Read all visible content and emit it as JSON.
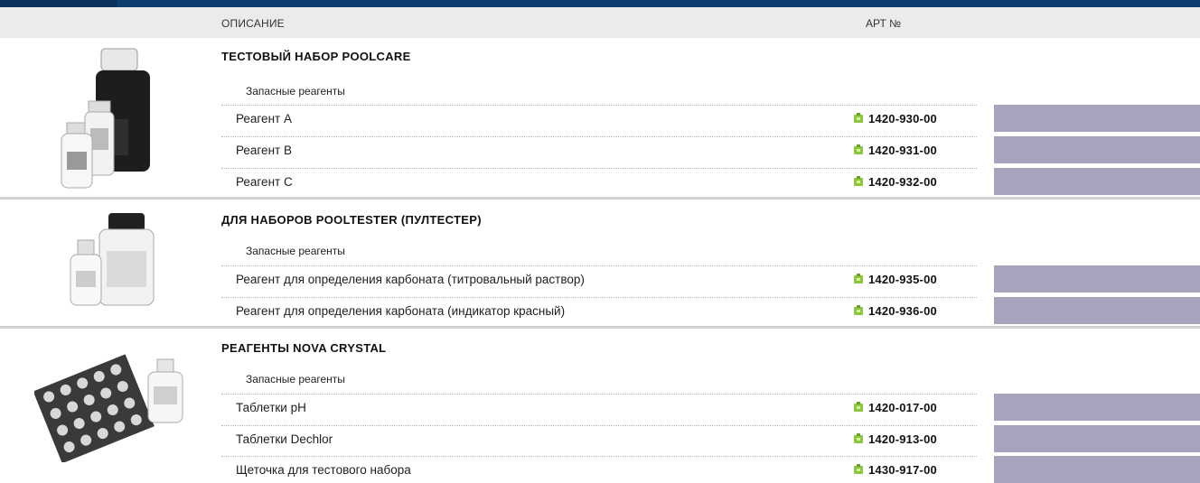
{
  "header": {
    "description_label": "ОПИСАНИЕ",
    "art_label": "АРТ №"
  },
  "colors": {
    "topbar": "#0d3d6e",
    "swatch": "#a8a3bd",
    "icon": "#8cc63f"
  },
  "sections": [
    {
      "title": "ТЕСТОВЫЙ НАБОР POOLCARE",
      "subtitle": "Запасные реагенты",
      "items": [
        {
          "name": "Реагент А",
          "art": "1420-930-00"
        },
        {
          "name": "Реагент В",
          "art": "1420-931-00"
        },
        {
          "name": "Реагент С",
          "art": "1420-932-00"
        }
      ]
    },
    {
      "title": "ДЛЯ НАБОРОВ POOLTESTER (ПУЛТЕСТЕР)",
      "subtitle": "Запасные реагенты",
      "items": [
        {
          "name": "Реагент для определения карбоната (титровальный раствор)",
          "art": "1420-935-00"
        },
        {
          "name": "Реагент для определения карбоната (индикатор красный)",
          "art": "1420-936-00"
        }
      ]
    },
    {
      "title": "РЕАГЕНТЫ NOVA CRYSTAL",
      "subtitle": "Запасные реагенты",
      "items": [
        {
          "name": "Таблетки pH",
          "art": "1420-017-00"
        },
        {
          "name": "Таблетки Dechlor",
          "art": "1420-913-00"
        },
        {
          "name": "Щеточка для тестового набора",
          "art": "1430-917-00"
        }
      ]
    }
  ]
}
